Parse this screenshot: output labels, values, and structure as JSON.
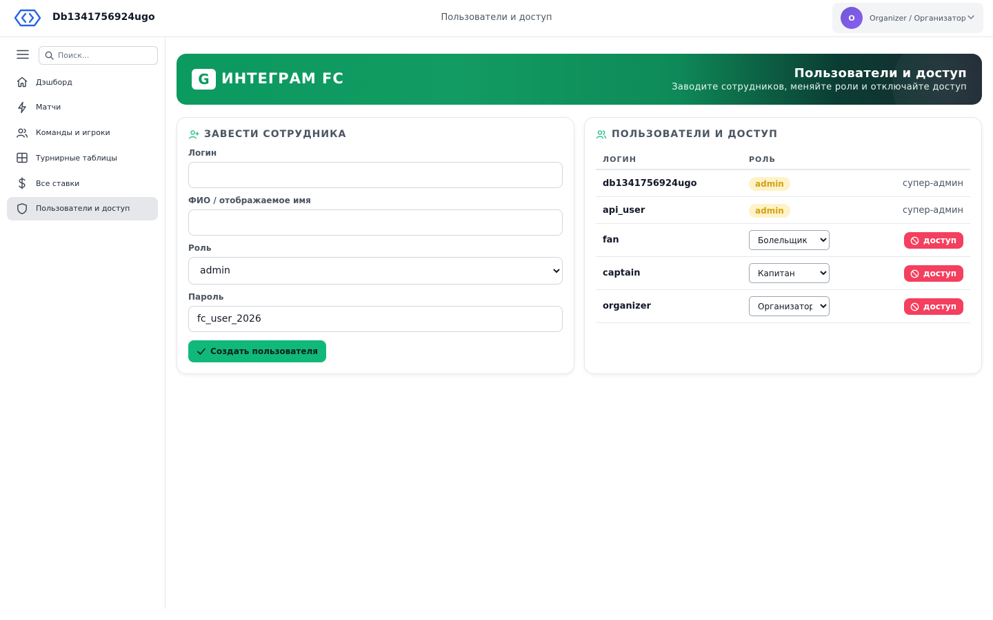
{
  "header": {
    "app_title": "Db1341756924ugo",
    "page_title": "Пользователи и доступ",
    "user": {
      "avatar_letter": "O",
      "label": "Organizer / Организатор"
    }
  },
  "sidebar": {
    "search_placeholder": "Поиск...",
    "items": [
      {
        "label": "Дэшборд",
        "icon": "home-icon"
      },
      {
        "label": "Матчи",
        "icon": "lightning-icon"
      },
      {
        "label": "Команды и игроки",
        "icon": "users-icon"
      },
      {
        "label": "Турнирные таблицы",
        "icon": "table-icon"
      },
      {
        "label": "Все ставки",
        "icon": "dollar-icon"
      },
      {
        "label": "Пользователи и доступ",
        "icon": "shield-icon",
        "active": true
      }
    ]
  },
  "banner": {
    "badge": "G",
    "brand": "ИНТЕГРАМ FC",
    "title": "Пользователи и доступ",
    "subtitle": "Заводите сотрудников, меняйте роли и отключайте доступ"
  },
  "create_form": {
    "heading": "ЗАВЕСТИ СОТРУДНИКА",
    "login_label": "Логин",
    "login_value": "",
    "name_label": "ФИО / отображаемое имя",
    "name_value": "",
    "role_label": "Роль",
    "role_value": "admin",
    "password_label": "Пароль",
    "password_value": "fc_user_2026",
    "submit_label": "Создать пользователя"
  },
  "users_panel": {
    "heading": "ПОЛЬЗОВАТЕЛИ И ДОСТУП",
    "col_login": "ЛОГИН",
    "col_role": "РОЛЬ",
    "rows": [
      {
        "login": "db1341756924ugo",
        "role": "admin",
        "status": "супер-админ"
      },
      {
        "login": "api_user",
        "role": "admin",
        "status": "супер-админ"
      },
      {
        "login": "fan",
        "role": "Болельщик",
        "action": "доступ"
      },
      {
        "login": "captain",
        "role": "Капитан",
        "action": "доступ"
      },
      {
        "login": "organizer",
        "role": "Организатор",
        "action": "доступ"
      }
    ]
  },
  "colors": {
    "accent": "#10b97a",
    "danger": "#f43f5e",
    "banner_start": "#0b9a5f",
    "banner_end": "#1b2530",
    "badge_bg": "#fef3c7",
    "badge_text": "#d4a017"
  }
}
